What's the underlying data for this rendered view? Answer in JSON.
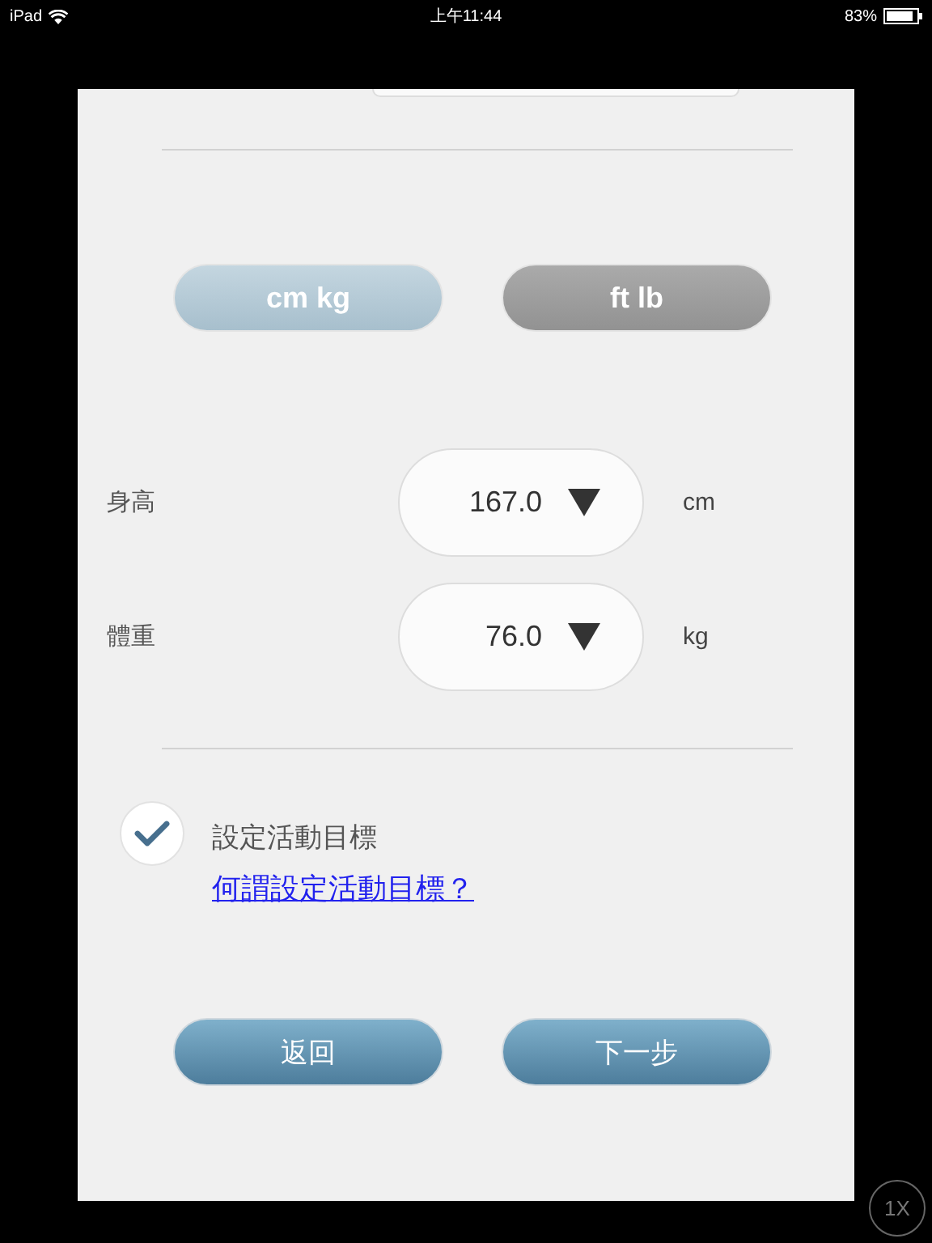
{
  "status_bar": {
    "device": "iPad",
    "time": "上午11:44",
    "battery": "83%"
  },
  "units": [
    {
      "label": "cm kg",
      "selected": true
    },
    {
      "label": "ft lb",
      "selected": false
    }
  ],
  "measurements": [
    {
      "label": "身高",
      "value": "167.0",
      "unit": "cm"
    },
    {
      "label": "體重",
      "value": "76.0",
      "unit": "kg"
    }
  ],
  "goal": {
    "label": "設定活動目標",
    "checked": true,
    "help_link": "何謂設定活動目標？"
  },
  "buttons": [
    {
      "label": "返回"
    },
    {
      "label": "下一步"
    }
  ],
  "zoom_button": {
    "label": "1X"
  }
}
